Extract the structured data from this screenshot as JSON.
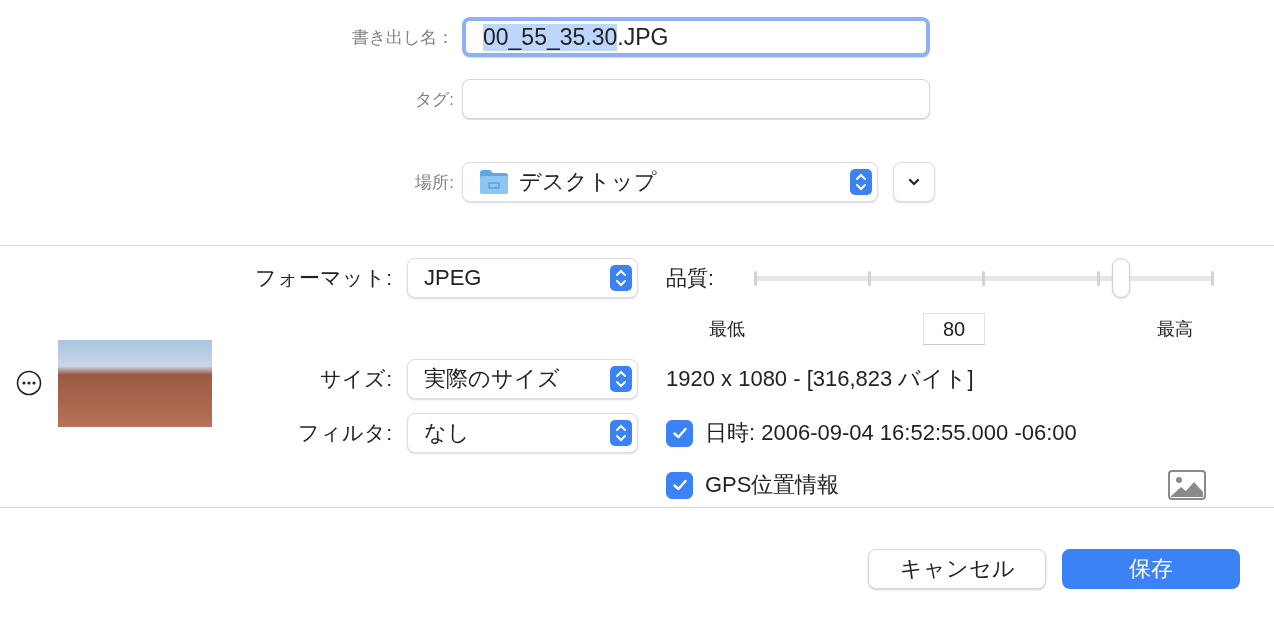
{
  "export_name": {
    "label": "書き出し名：",
    "selected_text": "00_55_35.30",
    "rest_text": ".JPG",
    "focused": true
  },
  "tags": {
    "label": "タグ:"
  },
  "location": {
    "label": "場所:",
    "value": "デスクトップ",
    "expanded": false
  },
  "format": {
    "label": "フォーマット:",
    "value": "JPEG"
  },
  "quality": {
    "label": "品質:",
    "level": 0.8,
    "min_label": "最低",
    "value": "80",
    "max_label": "最高"
  },
  "size": {
    "label": "サイズ:",
    "value": "実際のサイズ",
    "info": "1920 x 1080 - [316,823 バイト]"
  },
  "filter": {
    "label": "フィルタ:",
    "value": "なし"
  },
  "options": [
    {
      "label": "日時: 2006-09-04 16:52:55.000 -06:00",
      "checked": true
    },
    {
      "label": "GPS位置情報",
      "checked": true
    }
  ],
  "buttons": [
    {
      "label": "キャンセル",
      "kind": "secondary"
    },
    {
      "label": "保存",
      "kind": "primary"
    }
  ]
}
